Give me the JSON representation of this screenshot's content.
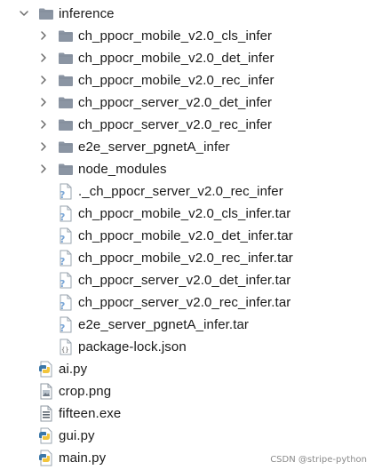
{
  "tree": {
    "root": {
      "label": "inference",
      "expanded": true,
      "icon": "folder-icon"
    },
    "root_children": [
      {
        "label": "ch_ppocr_mobile_v2.0_cls_infer",
        "type": "folder",
        "icon": "folder-icon"
      },
      {
        "label": "ch_ppocr_mobile_v2.0_det_infer",
        "type": "folder",
        "icon": "folder-icon"
      },
      {
        "label": "ch_ppocr_mobile_v2.0_rec_infer",
        "type": "folder",
        "icon": "folder-icon"
      },
      {
        "label": "ch_ppocr_server_v2.0_det_infer",
        "type": "folder",
        "icon": "folder-icon"
      },
      {
        "label": "ch_ppocr_server_v2.0_rec_infer",
        "type": "folder",
        "icon": "folder-icon"
      },
      {
        "label": "e2e_server_pgnetA_infer",
        "type": "folder",
        "icon": "folder-icon"
      },
      {
        "label": "node_modules",
        "type": "folder",
        "icon": "folder-icon"
      },
      {
        "label": "._ch_ppocr_server_v2.0_rec_infer",
        "type": "unknown-file",
        "icon": "unknown-file-icon"
      },
      {
        "label": "ch_ppocr_mobile_v2.0_cls_infer.tar",
        "type": "unknown-file",
        "icon": "unknown-file-icon"
      },
      {
        "label": "ch_ppocr_mobile_v2.0_det_infer.tar",
        "type": "unknown-file",
        "icon": "unknown-file-icon"
      },
      {
        "label": "ch_ppocr_mobile_v2.0_rec_infer.tar",
        "type": "unknown-file",
        "icon": "unknown-file-icon"
      },
      {
        "label": "ch_ppocr_server_v2.0_det_infer.tar",
        "type": "unknown-file",
        "icon": "unknown-file-icon"
      },
      {
        "label": "ch_ppocr_server_v2.0_rec_infer.tar",
        "type": "unknown-file",
        "icon": "unknown-file-icon"
      },
      {
        "label": "e2e_server_pgnetA_infer.tar",
        "type": "unknown-file",
        "icon": "unknown-file-icon"
      },
      {
        "label": "package-lock.json",
        "type": "json-file",
        "icon": "json-file-icon"
      }
    ],
    "top_level_files": [
      {
        "label": "ai.py",
        "type": "python-file",
        "icon": "python-file-icon"
      },
      {
        "label": "crop.png",
        "type": "image-file",
        "icon": "image-file-icon"
      },
      {
        "label": "fifteen.exe",
        "type": "exe-file",
        "icon": "exe-file-icon"
      },
      {
        "label": "gui.py",
        "type": "python-file",
        "icon": "python-file-icon"
      },
      {
        "label": "main.py",
        "type": "python-file",
        "icon": "python-file-icon"
      }
    ]
  },
  "watermark": "CSDN @stripe-python",
  "colors": {
    "folder": "#8b95a3",
    "folder_dark": "#6e7784",
    "chevron": "#6b6b6b",
    "text": "#1a1a1a",
    "python_blue": "#3b77a8",
    "python_yellow": "#f2c53d",
    "unknown_blue": "#7aa6d6"
  }
}
